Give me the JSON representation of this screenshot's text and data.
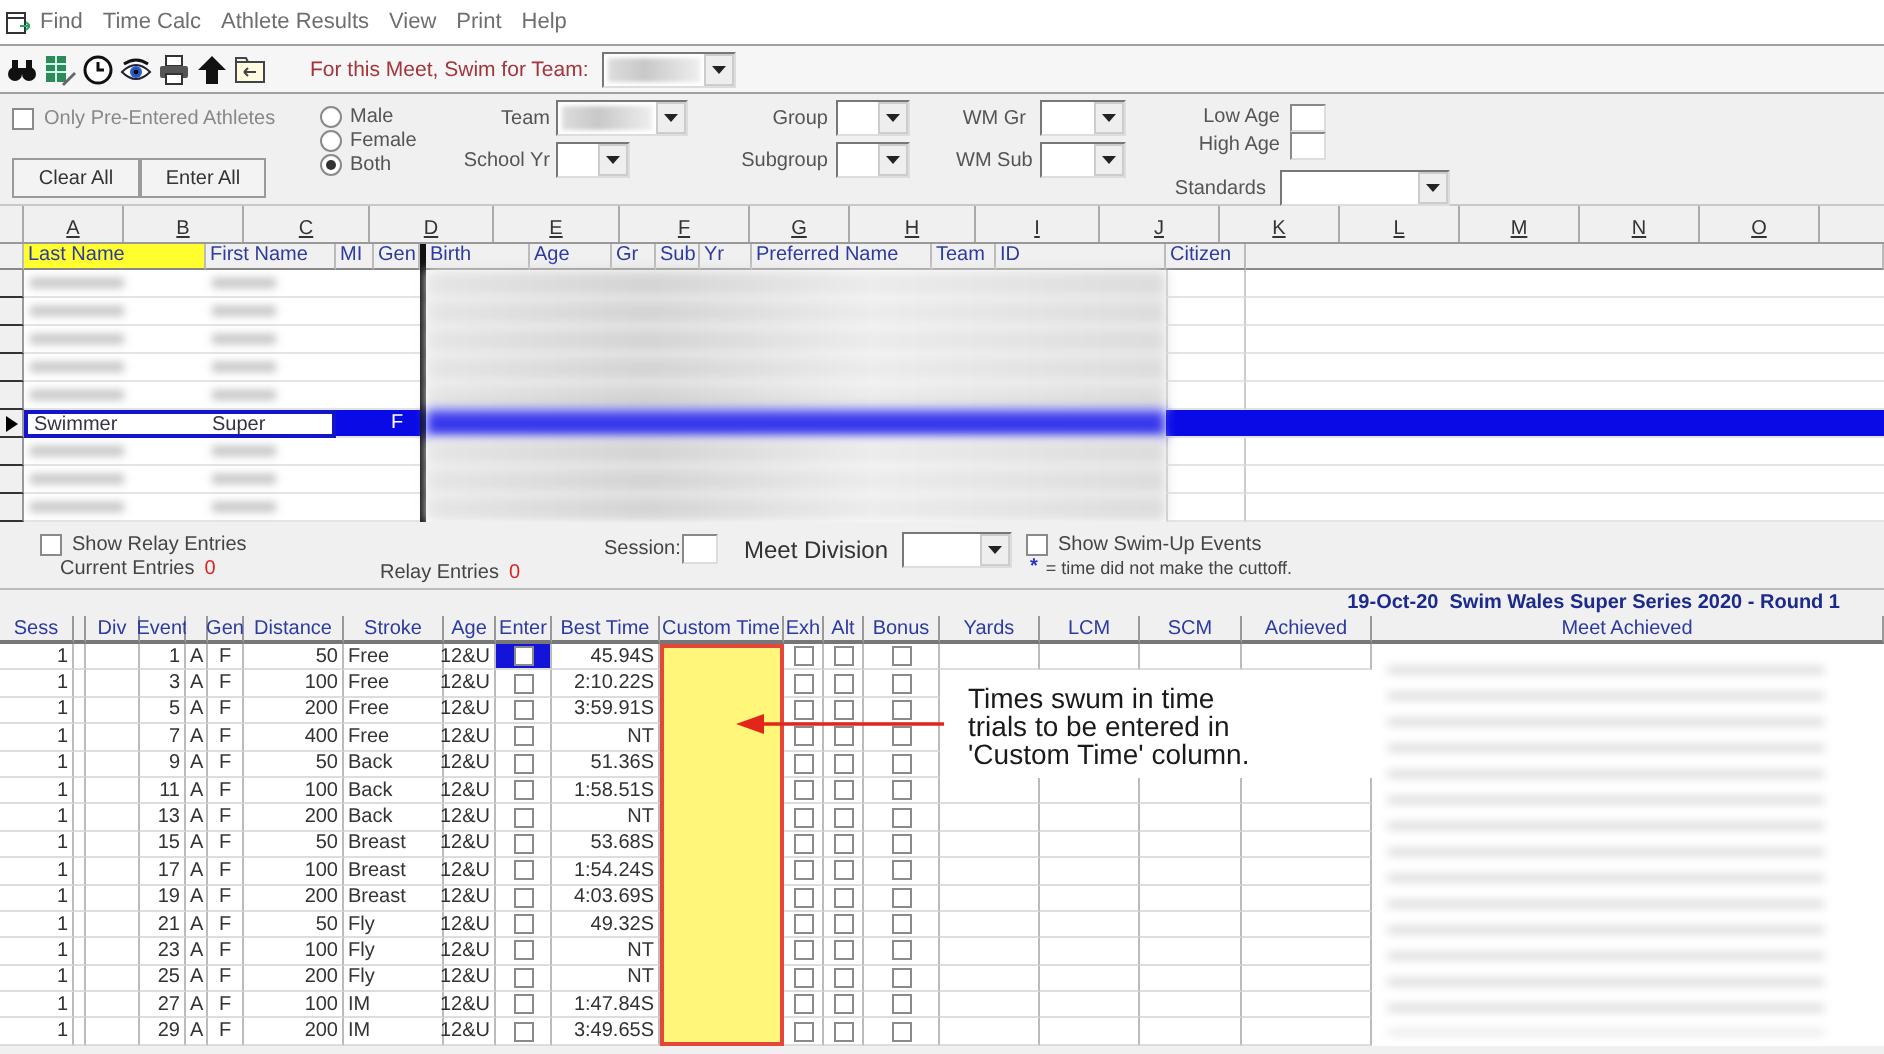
{
  "menu": [
    {
      "label": "Find"
    },
    {
      "label": "Time Calc"
    },
    {
      "label": "Athlete Results"
    },
    {
      "label": "View"
    },
    {
      "label": "Print"
    },
    {
      "label": "Help"
    }
  ],
  "toolbar": {
    "team_label": "For this Meet, Swim for Team:"
  },
  "filters": {
    "only_pre_entered": {
      "label": "Only Pre-Entered Athletes",
      "checked": false
    },
    "buttons": [
      {
        "label": "Clear All"
      },
      {
        "label": "Enter All"
      }
    ],
    "gender": [
      {
        "label": "Male",
        "selected": false
      },
      {
        "label": "Female",
        "selected": false
      },
      {
        "label": "Both",
        "selected": true
      }
    ],
    "team": {
      "label": "Team"
    },
    "school_yr": {
      "label": "School Yr"
    },
    "group": {
      "label": "Group"
    },
    "subgroup": {
      "label": "Subgroup"
    },
    "wm_gr": {
      "label": "WM Gr"
    },
    "wm_sub": {
      "label": "WM Sub"
    },
    "low_age": {
      "label": "Low Age"
    },
    "high_age": {
      "label": "High Age"
    },
    "standards": {
      "label": "Standards"
    }
  },
  "sheet_columns": [
    "A",
    "B",
    "C",
    "D",
    "E",
    "F",
    "G",
    "H",
    "I",
    "J",
    "K",
    "L",
    "M",
    "N",
    "O"
  ],
  "athletes": {
    "columns": [
      {
        "label": "Last Name",
        "sorted": true
      },
      {
        "label": "First Name",
        "sorted": false
      },
      {
        "label": "MI",
        "sorted": false
      },
      {
        "label": "Gen",
        "sorted": false
      },
      {
        "label": "Birth",
        "sorted": false
      },
      {
        "label": "Age",
        "sorted": false
      },
      {
        "label": "Gr",
        "sorted": false
      },
      {
        "label": "Sub",
        "sorted": false
      },
      {
        "label": "Yr",
        "sorted": false
      },
      {
        "label": "Preferred Name",
        "sorted": false
      },
      {
        "label": "Team",
        "sorted": false
      },
      {
        "label": "ID",
        "sorted": false
      },
      {
        "label": "Citizen",
        "sorted": false
      }
    ],
    "rows": [
      {
        "selected": false
      },
      {
        "selected": false
      },
      {
        "selected": false
      },
      {
        "selected": false
      },
      {
        "selected": false
      },
      {
        "selected": true,
        "last_name": "Swimmer",
        "first_name": "Super",
        "gen": "F"
      },
      {
        "selected": false
      },
      {
        "selected": false
      },
      {
        "selected": false
      }
    ]
  },
  "options": {
    "show_relay": {
      "label": "Show Relay Entries",
      "checked": false
    },
    "current_entries": {
      "label": "Current Entries",
      "count": "0"
    },
    "relay_entries": {
      "label": "Relay Entries",
      "count": "0"
    },
    "session": {
      "label": "Session:"
    },
    "meet_division": {
      "label": "Meet Division"
    },
    "show_swim_up": {
      "label": "Show Swim-Up Events",
      "checked": false
    },
    "legend": {
      "mark": "*",
      "text": "= time did not make the cuttoff."
    }
  },
  "meet_title": "19-Oct-20  Swim Wales Super Series 2020 - Round 1",
  "events": {
    "columns": [
      {
        "kind": "label",
        "label": "Sess"
      },
      {
        "kind": "blank"
      },
      {
        "kind": "label",
        "label": "Div"
      },
      {
        "kind": "label",
        "label": "Event"
      },
      {
        "kind": "blank"
      },
      {
        "kind": "label",
        "label": "Gen"
      },
      {
        "kind": "label",
        "label": "Distance"
      },
      {
        "kind": "label",
        "label": "Stroke"
      },
      {
        "kind": "label",
        "label": "Age"
      },
      {
        "kind": "label",
        "label": "Enter"
      },
      {
        "kind": "label",
        "label": "Best Time"
      },
      {
        "kind": "label",
        "label": "Custom Time"
      },
      {
        "kind": "label",
        "label": "Exh"
      },
      {
        "kind": "label",
        "label": "Alt"
      },
      {
        "kind": "label",
        "label": "Bonus"
      },
      {
        "kind": "label",
        "label": "Yards"
      },
      {
        "kind": "label",
        "label": "LCM"
      },
      {
        "kind": "label",
        "label": "SCM"
      },
      {
        "kind": "label",
        "label": "Achieved"
      },
      {
        "kind": "label",
        "label": "Meet Achieved"
      }
    ],
    "rows": [
      {
        "sess": "1",
        "event": "1",
        "heat": "A",
        "gen": "F",
        "distance": "50",
        "stroke": "Free",
        "age": "12&U",
        "enter": false,
        "selected": true,
        "best_time": "45.94S",
        "exh": false,
        "alt": false,
        "bonus": false
      },
      {
        "sess": "1",
        "event": "3",
        "heat": "A",
        "gen": "F",
        "distance": "100",
        "stroke": "Free",
        "age": "12&U",
        "enter": false,
        "selected": false,
        "best_time": "2:10.22S",
        "exh": false,
        "alt": false,
        "bonus": false
      },
      {
        "sess": "1",
        "event": "5",
        "heat": "A",
        "gen": "F",
        "distance": "200",
        "stroke": "Free",
        "age": "12&U",
        "enter": false,
        "selected": false,
        "best_time": "3:59.91S",
        "exh": false,
        "alt": false,
        "bonus": false
      },
      {
        "sess": "1",
        "event": "7",
        "heat": "A",
        "gen": "F",
        "distance": "400",
        "stroke": "Free",
        "age": "12&U",
        "enter": false,
        "selected": false,
        "best_time": "NT",
        "exh": false,
        "alt": false,
        "bonus": false
      },
      {
        "sess": "1",
        "event": "9",
        "heat": "A",
        "gen": "F",
        "distance": "50",
        "stroke": "Back",
        "age": "12&U",
        "enter": false,
        "selected": false,
        "best_time": "51.36S",
        "exh": false,
        "alt": false,
        "bonus": false
      },
      {
        "sess": "1",
        "event": "11",
        "heat": "A",
        "gen": "F",
        "distance": "100",
        "stroke": "Back",
        "age": "12&U",
        "enter": false,
        "selected": false,
        "best_time": "1:58.51S",
        "exh": false,
        "alt": false,
        "bonus": false
      },
      {
        "sess": "1",
        "event": "13",
        "heat": "A",
        "gen": "F",
        "distance": "200",
        "stroke": "Back",
        "age": "12&U",
        "enter": false,
        "selected": false,
        "best_time": "NT",
        "exh": false,
        "alt": false,
        "bonus": false
      },
      {
        "sess": "1",
        "event": "15",
        "heat": "A",
        "gen": "F",
        "distance": "50",
        "stroke": "Breast",
        "age": "12&U",
        "enter": false,
        "selected": false,
        "best_time": "53.68S",
        "exh": false,
        "alt": false,
        "bonus": false
      },
      {
        "sess": "1",
        "event": "17",
        "heat": "A",
        "gen": "F",
        "distance": "100",
        "stroke": "Breast",
        "age": "12&U",
        "enter": false,
        "selected": false,
        "best_time": "1:54.24S",
        "exh": false,
        "alt": false,
        "bonus": false
      },
      {
        "sess": "1",
        "event": "19",
        "heat": "A",
        "gen": "F",
        "distance": "200",
        "stroke": "Breast",
        "age": "12&U",
        "enter": false,
        "selected": false,
        "best_time": "4:03.69S",
        "exh": false,
        "alt": false,
        "bonus": false
      },
      {
        "sess": "1",
        "event": "21",
        "heat": "A",
        "gen": "F",
        "distance": "50",
        "stroke": "Fly",
        "age": "12&U",
        "enter": false,
        "selected": false,
        "best_time": "49.32S",
        "exh": false,
        "alt": false,
        "bonus": false
      },
      {
        "sess": "1",
        "event": "23",
        "heat": "A",
        "gen": "F",
        "distance": "100",
        "stroke": "Fly",
        "age": "12&U",
        "enter": false,
        "selected": false,
        "best_time": "NT",
        "exh": false,
        "alt": false,
        "bonus": false
      },
      {
        "sess": "1",
        "event": "25",
        "heat": "A",
        "gen": "F",
        "distance": "200",
        "stroke": "Fly",
        "age": "12&U",
        "enter": false,
        "selected": false,
        "best_time": "NT",
        "exh": false,
        "alt": false,
        "bonus": false
      },
      {
        "sess": "1",
        "event": "27",
        "heat": "A",
        "gen": "F",
        "distance": "100",
        "stroke": "IM",
        "age": "12&U",
        "enter": false,
        "selected": false,
        "best_time": "1:47.84S",
        "exh": false,
        "alt": false,
        "bonus": false
      },
      {
        "sess": "1",
        "event": "29",
        "heat": "A",
        "gen": "F",
        "distance": "200",
        "stroke": "IM",
        "age": "12&U",
        "enter": false,
        "selected": false,
        "best_time": "3:49.65S",
        "exh": false,
        "alt": false,
        "bonus": false
      }
    ]
  },
  "annotation": {
    "text": "Times swum in time trials to be entered in 'Custom Time' column."
  }
}
